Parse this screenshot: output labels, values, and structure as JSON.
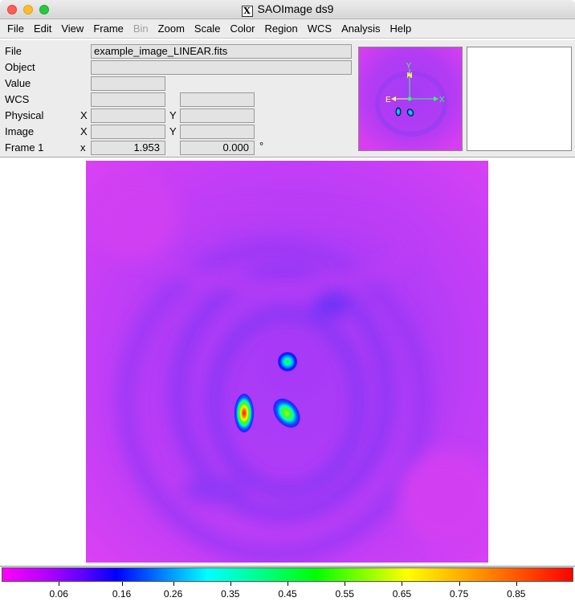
{
  "window": {
    "title": "SAOImage ds9",
    "title_icon": "X"
  },
  "menu": [
    "File",
    "Edit",
    "View",
    "Frame",
    "Bin",
    "Zoom",
    "Scale",
    "Color",
    "Region",
    "WCS",
    "Analysis",
    "Help"
  ],
  "menu_disabled": [
    "Bin"
  ],
  "info_panel": {
    "file_label": "File",
    "file_value": "example_image_LINEAR.fits",
    "object_label": "Object",
    "object_value": "",
    "value_label": "Value",
    "value_value": "",
    "wcs_label": "WCS",
    "wcs_value1": "",
    "wcs_value2": "",
    "physical_label": "Physical",
    "physical_x_label": "X",
    "physical_y_label": "Y",
    "physical_x": "",
    "physical_y": "",
    "image_label": "Image",
    "image_x_label": "X",
    "image_y_label": "Y",
    "image_x": "",
    "image_y": "",
    "frame_label": "Frame 1",
    "frame_x_label": "x",
    "frame_zoom": "1.953",
    "frame_angle": "0.000",
    "frame_angle_unit": "°"
  },
  "panner": {
    "north_label": "N",
    "y_label": "Y",
    "east_label": "E",
    "x_label": "X"
  },
  "colorbar": {
    "colormap": "rainbow",
    "ticks": [
      "0.06",
      "0.16",
      "0.26",
      "0.35",
      "0.45",
      "0.55",
      "0.65",
      "0.75",
      "0.85"
    ],
    "tick_positions": [
      0.1,
      0.21,
      0.3,
      0.4,
      0.5,
      0.6,
      0.7,
      0.8,
      0.9
    ]
  },
  "colors": {
    "background_magenta": "#c23dfa",
    "hotspot": "#ff0000"
  }
}
